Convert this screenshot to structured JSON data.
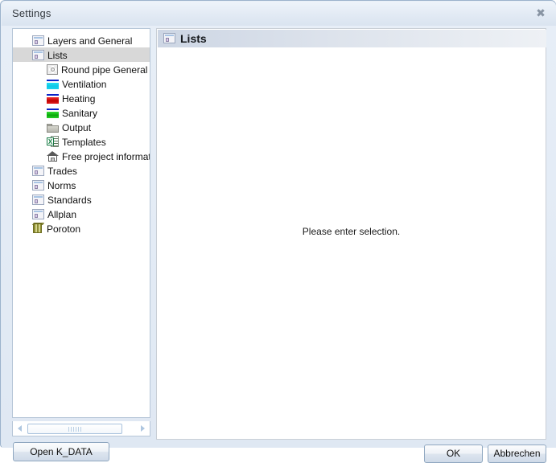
{
  "window": {
    "title": "Settings",
    "close_icon": "close-icon",
    "close_glyph": "✖"
  },
  "tree": {
    "items": [
      {
        "label": "Layers and General",
        "icon": "window-icon",
        "level": 0,
        "selected": false
      },
      {
        "label": "Lists",
        "icon": "window-icon",
        "level": 0,
        "selected": true
      },
      {
        "label": "Round pipe General",
        "icon": "gear-icon",
        "level": 1,
        "selected": false
      },
      {
        "label": "Ventilation",
        "icon": "ventilation-duct-icon",
        "level": 1,
        "selected": false
      },
      {
        "label": "Heating",
        "icon": "heating-duct-icon",
        "level": 1,
        "selected": false
      },
      {
        "label": "Sanitary",
        "icon": "sanitary-duct-icon",
        "level": 1,
        "selected": false
      },
      {
        "label": "Output",
        "icon": "folder-icon",
        "level": 1,
        "selected": false
      },
      {
        "label": "Templates",
        "icon": "spreadsheet-icon",
        "level": 1,
        "selected": false
      },
      {
        "label": "Free project informat",
        "icon": "house-icon",
        "level": 1,
        "selected": false
      },
      {
        "label": "Trades",
        "icon": "window-icon",
        "level": 0,
        "selected": false
      },
      {
        "label": "Norms",
        "icon": "window-icon",
        "level": 0,
        "selected": false
      },
      {
        "label": "Standards",
        "icon": "window-icon",
        "level": 0,
        "selected": false
      },
      {
        "label": "Allplan",
        "icon": "window-icon",
        "level": 0,
        "selected": false
      },
      {
        "label": "Poroton",
        "icon": "brick-icon",
        "level": 0,
        "selected": false
      }
    ],
    "scrollbar": {
      "left_arrow": "◀",
      "right_arrow": "▶"
    }
  },
  "content": {
    "header_title": "Lists",
    "header_icon": "window-icon",
    "message": "Please enter selection."
  },
  "buttons": {
    "open": "Open K_DATA",
    "ok": "OK",
    "cancel": "Abbrechen"
  },
  "colors": {
    "accent": "#a8c4e4",
    "selection": "#d8d8d8",
    "frame": "#9cb3cc",
    "ventilation": "#18d4ee",
    "heating": "#c00000",
    "sanitary": "#0aa80a",
    "poroton": "#8d8d33"
  },
  "icon_glyphs": {
    "spreadsheet_letter": "X"
  }
}
